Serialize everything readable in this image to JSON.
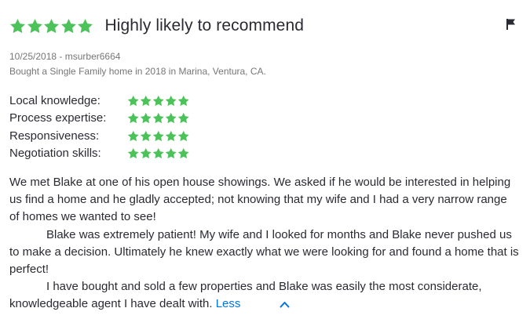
{
  "review": {
    "overall_rating": 5,
    "max_rating": 5,
    "title": "Highly likely to recommend",
    "date_author": "10/25/2018 - msurber6664",
    "purchase_info": "Bought a Single Family home in 2018 in Marina, Ventura, CA.",
    "sub_ratings": [
      {
        "label": "Local knowledge:",
        "rating": 5
      },
      {
        "label": "Process expertise:",
        "rating": 5
      },
      {
        "label": "Responsiveness:",
        "rating": 5
      },
      {
        "label": "Negotiation skills:",
        "rating": 5
      }
    ],
    "paragraphs": [
      "We met Blake at one of his open house showings. We asked if he would be interested in helping us find a home and he gladly accepted; not knowing that my wife and I had a very narrow range of homes we wanted to see!",
      "Blake was extremely patient! My wife and I looked for months and Blake never pushed us to make a decision. Ultimately he knew exactly what we were looking for and found a home that is perfect!",
      "I have bought and sold a few properties and Blake was easily the most considerate, knowledgeable agent I have dealt with."
    ],
    "less_label": "Less"
  },
  "icons": {
    "star": "star-icon",
    "flag": "flag-icon",
    "less": "chevron-up-icon"
  },
  "colors": {
    "star": "#4dc25a",
    "link": "#0074e4",
    "text": "#2a2a33",
    "meta": "#767676"
  }
}
